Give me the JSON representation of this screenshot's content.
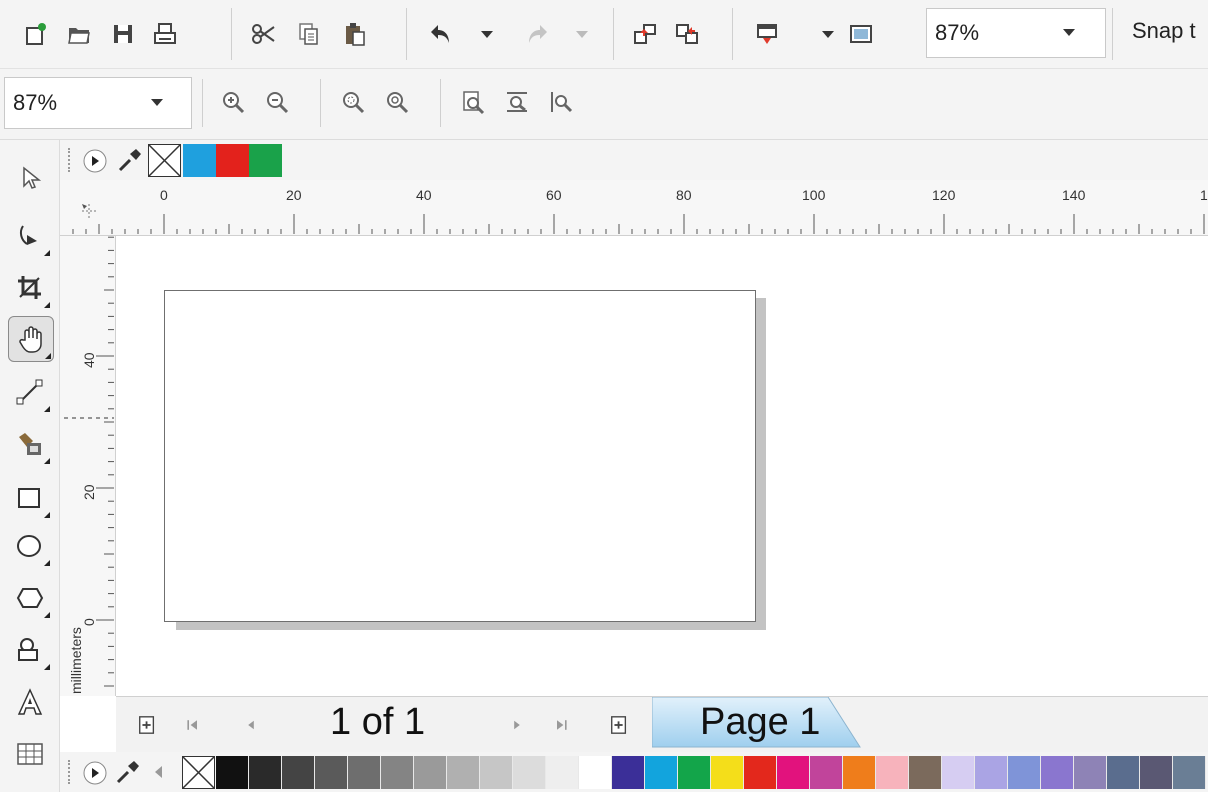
{
  "toolbar": {
    "zoom_value": "87%",
    "snap_label": "Snap t"
  },
  "zoom_toolbar": {
    "zoom_value": "87%"
  },
  "ruler": {
    "unit_label": "millimeters",
    "horizontal_ticks": [
      "0",
      "20",
      "40",
      "60",
      "80",
      "100",
      "120",
      "140",
      "1"
    ],
    "vertical_ticks": [
      "40",
      "20",
      "0"
    ]
  },
  "page_nav": {
    "count": "1 of 1",
    "tab_label": "Page 1"
  },
  "document_palette": {
    "colors": [
      "#1fa0de",
      "#e3221c",
      "#1aa24a"
    ]
  },
  "color_palette": {
    "colors": [
      "#111111",
      "#2a2a2a",
      "#444444",
      "#5a5a5a",
      "#6e6e6e",
      "#848484",
      "#9a9a9a",
      "#b0b0b0",
      "#c6c6c6",
      "#dcdcdc",
      "#eeeeee",
      "#ffffff",
      "#3b2f98",
      "#12a4dd",
      "#13a54a",
      "#f4de1a",
      "#e3281c",
      "#e2127d",
      "#c1449b",
      "#ef7d1b",
      "#f7b3bc",
      "#7b6a5c",
      "#d6cdf2",
      "#aaa4e4",
      "#7f94d8",
      "#8a76cf",
      "#8e83b6",
      "#5a6d8e",
      "#5a5873",
      "#6a7e95"
    ]
  },
  "colors": {
    "page_tab": "#bfe0f4",
    "active_tool_bg": "#e2e2e2"
  }
}
